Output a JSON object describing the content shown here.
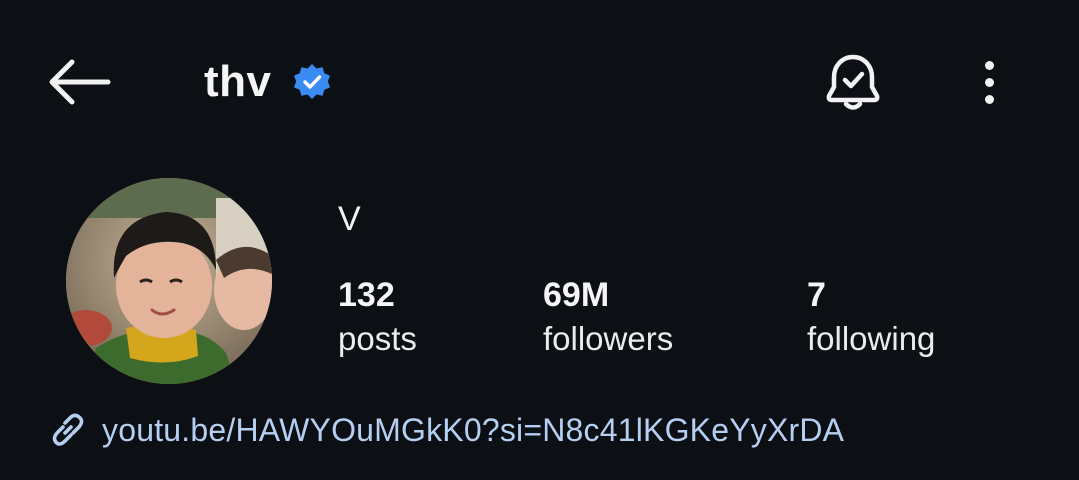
{
  "header": {
    "username": "thv",
    "back_icon": "arrow-left-icon",
    "verified_icon": "verified-badge-icon",
    "notification_icon": "bell-check-icon",
    "more_icon": "more-vertical-icon"
  },
  "profile": {
    "display_name": "V",
    "stats": [
      {
        "value": "132",
        "label": "posts"
      },
      {
        "value": "69M",
        "label": "followers"
      },
      {
        "value": "7",
        "label": "following"
      }
    ],
    "link": {
      "icon": "link-icon",
      "text": "youtu.be/HAWYOuMGkK0?si=N8c41lKGKeYyXrDA"
    }
  },
  "colors": {
    "background": "#0c0f14",
    "verified": "#3b8cf2",
    "link": "#b5cff2",
    "text": "#f2f2f2"
  }
}
